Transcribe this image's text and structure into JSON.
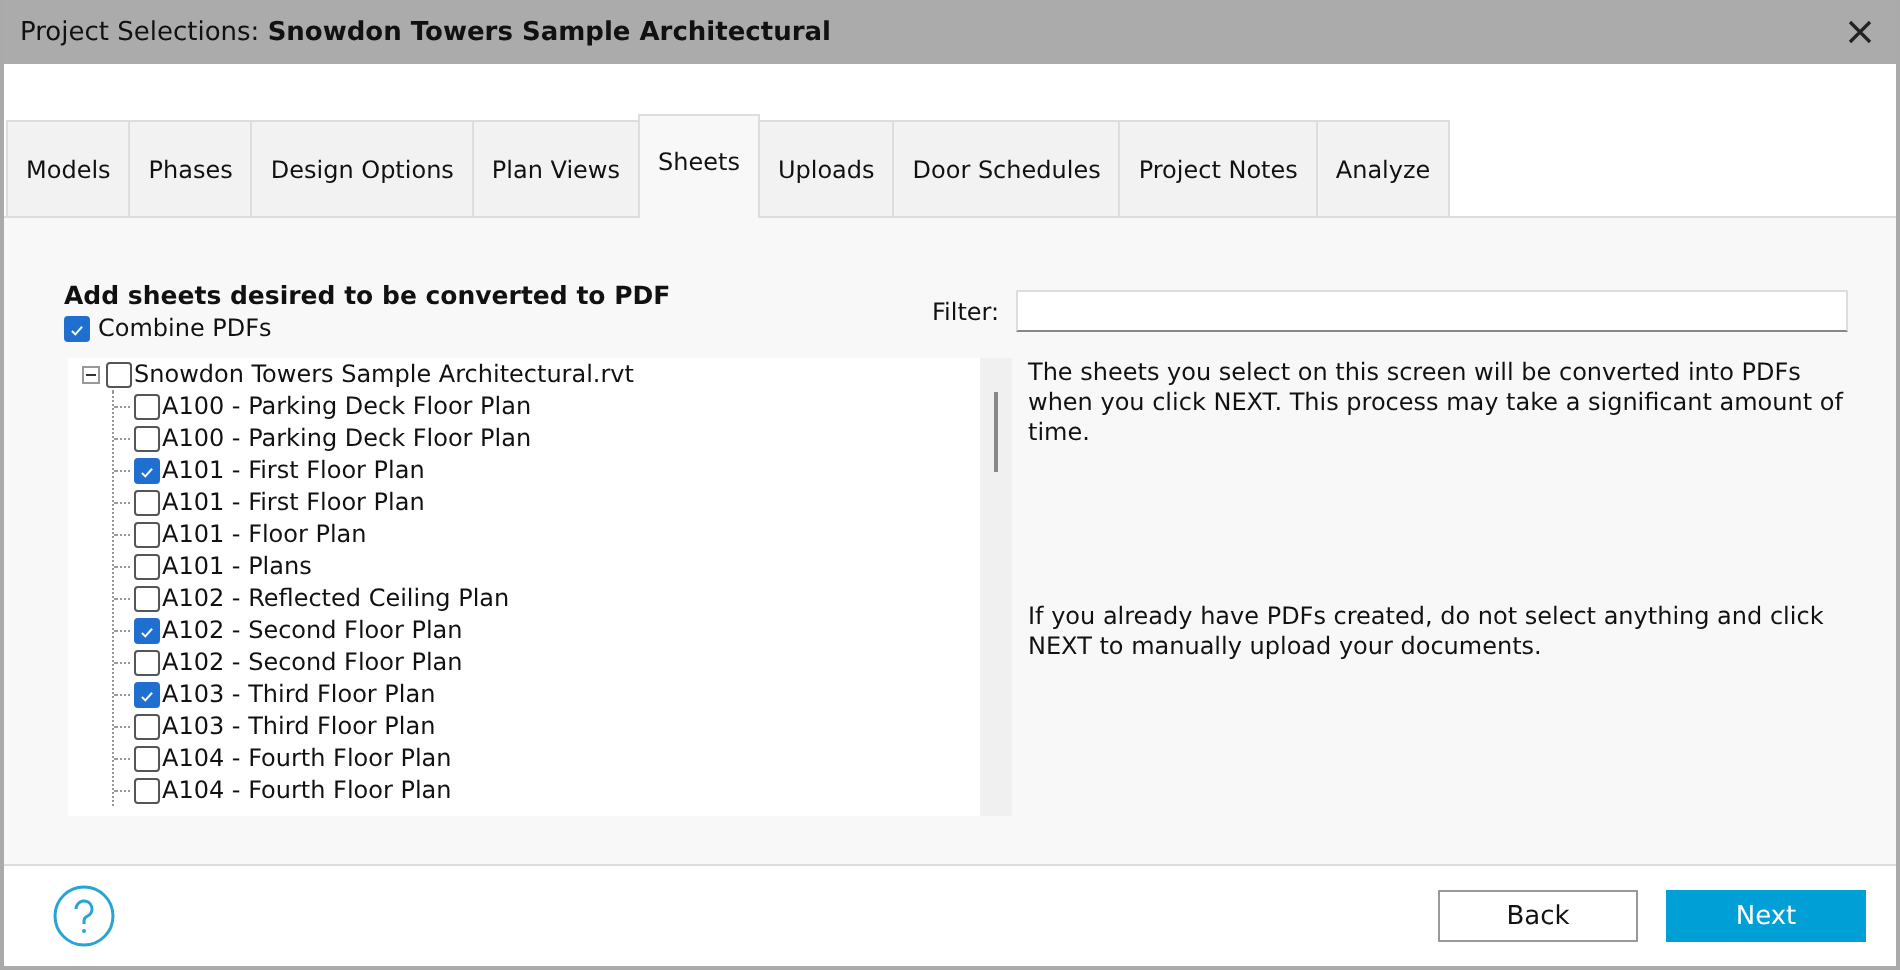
{
  "window": {
    "title": "Project Selections: **Snowdon Towers Sample Architectural**"
  },
  "tabs": [
    {
      "label": "Models",
      "selected": false
    },
    {
      "label": "Phases",
      "selected": false
    },
    {
      "label": "Design Options",
      "selected": false
    },
    {
      "label": "Plan Views",
      "selected": false
    },
    {
      "label": "Sheets",
      "selected": true
    },
    {
      "label": "Uploads",
      "selected": false
    },
    {
      "label": "Door Schedules",
      "selected": false
    },
    {
      "label": "Project Notes",
      "selected": false
    },
    {
      "label": "Analyze",
      "selected": false
    }
  ],
  "heading": "Add sheets desired to be converted to PDF",
  "combine": {
    "label": "Combine PDFs",
    "checked": true
  },
  "filter": {
    "label": "Filter:"
  },
  "tree": [
    {
      "label": "Snowdon Towers Sample Architectural.rvt",
      "checked": false,
      "expanded": true,
      "children": [
        {
          "label": "A100 - Parking Deck Floor Plan",
          "checked": false
        },
        {
          "label": "A100 - Parking Deck Floor Plan",
          "checked": false
        },
        {
          "label": "A101 - First Floor Plan",
          "checked": true
        },
        {
          "label": "A101 - First Floor Plan",
          "checked": false
        },
        {
          "label": "A101 - Floor Plan",
          "checked": false
        },
        {
          "label": "A101 - Plans",
          "checked": false
        },
        {
          "label": "A102 - Reflected Ceiling Plan",
          "checked": false
        },
        {
          "label": "A102 - Second Floor Plan",
          "checked": true
        },
        {
          "label": "A102 - Second Floor Plan",
          "checked": false
        },
        {
          "label": "A103 - Third Floor Plan",
          "checked": true
        },
        {
          "label": "A103 - Third Floor Plan",
          "checked": false
        },
        {
          "label": "A104 - Fourth Floor Plan",
          "checked": false
        },
        {
          "label": "A104 - Fourth Floor Plan",
          "checked": false
        }
      ]
    }
  ],
  "info": [
    "The sheets you select on this screen will be converted into PDFs when you click NEXT. This process may take a significant amount of time.",
    "If you already have PDFs created, do not select anything and click NEXT to manually upload your documents."
  ],
  "buttons": [
    {
      "label": "Back",
      "kind": "secondary"
    },
    {
      "label": "Next",
      "kind": "primary"
    }
  ]
}
